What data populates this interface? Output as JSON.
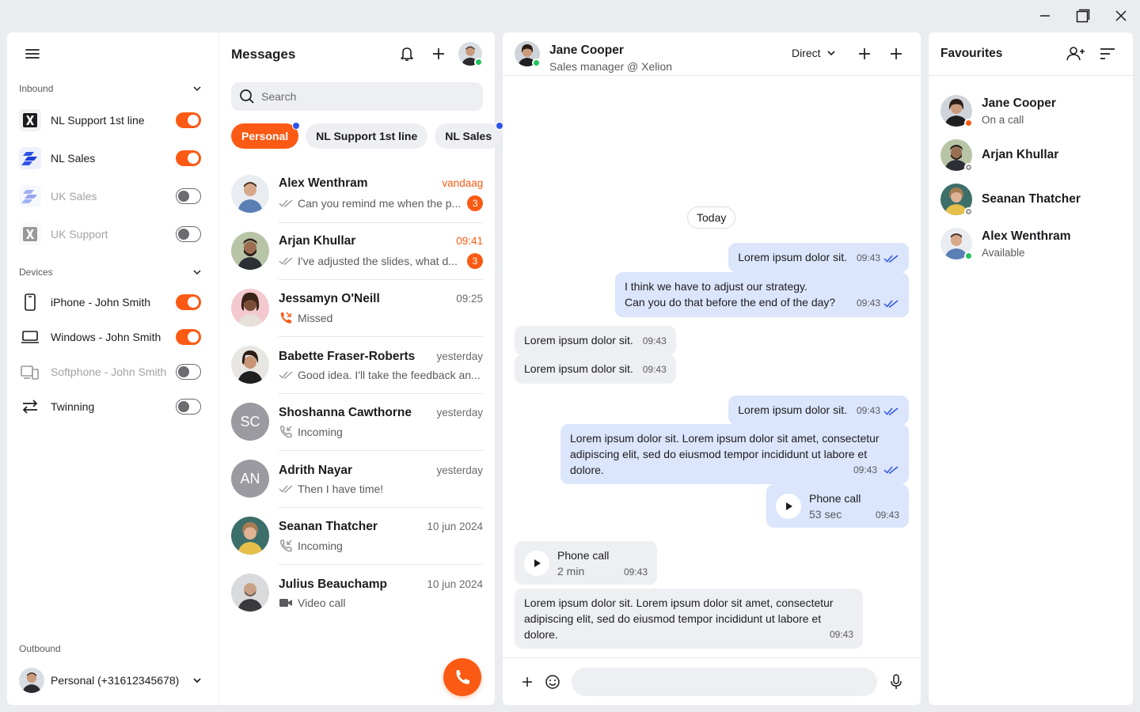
{
  "colors": {
    "accent": "#fa5a14",
    "online": "#22c55e",
    "busy": "#fa5a14",
    "offline": "#8e8e93",
    "unread_dot": "#2f54eb",
    "outgoing_bubble": "#dbe5fb",
    "incoming_bubble": "#eeeff2"
  },
  "window": {
    "minimize_icon": "minimize-icon",
    "maximize_icon": "maximize-icon",
    "close_icon": "close-icon"
  },
  "sidebar": {
    "inbound_label": "Inbound",
    "lines": [
      {
        "label": "NL Support 1st line",
        "logo": "x-logo",
        "enabled": true
      },
      {
        "label": "NL Sales",
        "logo": "blue-stripes-logo",
        "enabled": true
      },
      {
        "label": "UK Sales",
        "logo": "blue-stripes-logo",
        "enabled": false
      },
      {
        "label": "UK Support",
        "logo": "x-logo",
        "enabled": false
      }
    ],
    "devices_label": "Devices",
    "devices": [
      {
        "label": "iPhone - John Smith",
        "icon": "phone-icon",
        "enabled": true
      },
      {
        "label": "Windows - John Smith",
        "icon": "laptop-icon",
        "enabled": true
      },
      {
        "label": "Softphone - John Smith",
        "icon": "softphone-icon",
        "enabled": false
      },
      {
        "label": "Twinning",
        "icon": "twinning-icon",
        "enabled": false
      }
    ],
    "outbound_label": "Outbound",
    "outbound_value": "Personal (+31612345678)"
  },
  "messages": {
    "title": "Messages",
    "search_placeholder": "Search",
    "chips": [
      {
        "label": "Personal",
        "active": true,
        "dot": true
      },
      {
        "label": "NL Support 1st line",
        "active": false,
        "dot": false
      },
      {
        "label": "NL Sales",
        "active": false,
        "dot": true
      }
    ],
    "conversations": [
      {
        "name": "Alex Wenthram",
        "time": "vandaag",
        "highlight": true,
        "preview": "Can you remind me when the p...",
        "icon": "double-check-icon",
        "badge": "3"
      },
      {
        "name": "Arjan Khullar",
        "time": "09:41",
        "highlight": true,
        "preview": "I've adjusted the slides, what d...",
        "icon": "double-check-icon",
        "badge": "3"
      },
      {
        "name": "Jessamyn O'Neill",
        "time": "09:25",
        "highlight": false,
        "preview": "Missed",
        "icon": "missed-call-icon",
        "badge": ""
      },
      {
        "name": "Babette Fraser-Roberts",
        "time": "yesterday",
        "highlight": false,
        "preview": "Good idea. I'll take the feedback an...",
        "icon": "double-check-icon",
        "badge": ""
      },
      {
        "name": "Shoshanna Cawthorne",
        "time": "yesterday",
        "highlight": false,
        "preview": "Incoming",
        "icon": "incoming-call-icon",
        "badge": "",
        "initials": "SC"
      },
      {
        "name": "Adrith Nayar",
        "time": "yesterday",
        "highlight": false,
        "preview": "Then I have time!",
        "icon": "double-check-icon",
        "badge": "",
        "initials": "AN"
      },
      {
        "name": "Seanan Thatcher",
        "time": "10 jun 2024",
        "highlight": false,
        "preview": "Incoming",
        "icon": "incoming-call-icon",
        "badge": ""
      },
      {
        "name": "Julius Beauchamp",
        "time": "10 jun 2024",
        "highlight": false,
        "preview": "Video call",
        "icon": "video-icon",
        "badge": ""
      }
    ]
  },
  "chat": {
    "name": "Jane Cooper",
    "subtitle": "Sales manager @ Xelion",
    "mode": "Direct",
    "day_separator": "Today",
    "messages": [
      {
        "dir": "out",
        "text": "Lorem ipsum dolor sit.",
        "time": "09:43"
      },
      {
        "dir": "out",
        "line1": "I think we have to adjust our strategy.",
        "line2": "Can you do that before the end of the day?",
        "time": "09:43"
      },
      {
        "dir": "in",
        "text": "Lorem ipsum dolor sit.",
        "time": "09:43"
      },
      {
        "dir": "in",
        "text": "Lorem ipsum dolor sit.",
        "time": "09:43"
      },
      {
        "dir": "out",
        "text": "Lorem ipsum dolor sit.",
        "time": "09:43"
      },
      {
        "dir": "out",
        "text": "Lorem ipsum dolor sit. Lorem ipsum dolor sit amet, consectetur adipiscing elit, sed do eiusmod tempor incididunt ut labore et dolore.",
        "time": "09:43"
      },
      {
        "dir": "out",
        "call_title": "Phone call",
        "call_duration": "53 sec",
        "time": "09:43"
      },
      {
        "dir": "in",
        "call_title": "Phone call",
        "call_duration": "2 min",
        "time": "09:43"
      },
      {
        "dir": "in",
        "text": "Lorem ipsum dolor sit. Lorem ipsum dolor sit amet, consectetur adipiscing elit, sed do eiusmod tempor incididunt ut labore et dolore.",
        "time": "09:43"
      }
    ],
    "composer_placeholder": ""
  },
  "favourites": {
    "title": "Favourites",
    "items": [
      {
        "name": "Jane Cooper",
        "status": "On a call",
        "state": "busy"
      },
      {
        "name": "Arjan Khullar",
        "status": "",
        "state": "offline"
      },
      {
        "name": "Seanan Thatcher",
        "status": "",
        "state": "offline"
      },
      {
        "name": "Alex Wenthram",
        "status": "Available",
        "state": "online"
      }
    ]
  }
}
